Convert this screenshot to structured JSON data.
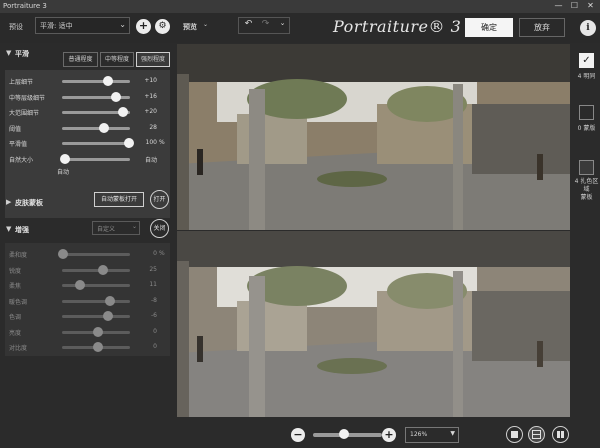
{
  "window": {
    "title": "Portraiture 3",
    "minimize": "—",
    "maximize": "☐",
    "close": "✕"
  },
  "header": {
    "preset_label": "预设",
    "preset_value": "平滑: 适中",
    "add_icon": "+",
    "settings_icon": "⚙",
    "preview_label": "预览",
    "logo": "Portraiture® 3",
    "ok_label": "确定",
    "cancel_label": "放弃",
    "info_icon": "i"
  },
  "smoothing": {
    "title": "平滑",
    "modes": [
      "普通程度",
      "中等程度",
      "强烈程度"
    ],
    "active_mode": "强烈程度",
    "sliders": [
      {
        "label": "上层细节",
        "value": "+10",
        "fraction": 0.68
      },
      {
        "label": "中等层级细节",
        "value": "+16",
        "fraction": 0.8
      },
      {
        "label": "大范围细节",
        "value": "+20",
        "fraction": 0.9
      },
      {
        "label": "阈值",
        "value": "28",
        "fraction": 0.62
      },
      {
        "label": "平滑值",
        "value": "100",
        "unit": "%",
        "fraction": 0.98
      },
      {
        "label": "自然大小",
        "value": "自动",
        "fraction": 0.05
      }
    ],
    "auto_text": "自动"
  },
  "skin_mask": {
    "title": "皮肤蒙板",
    "auto_mask_button": "自动蒙板打开",
    "toggle_button": "打开"
  },
  "enhance": {
    "title": "增强",
    "dropdown_value": "自定义",
    "toggle_button": "关闭",
    "sliders": [
      {
        "label": "柔和度",
        "value": "0",
        "unit": "%",
        "fraction": 0.02
      },
      {
        "label": "锐度",
        "value": "25",
        "fraction": 0.6
      },
      {
        "label": "柔焦",
        "value": "11",
        "fraction": 0.27
      },
      {
        "label": "暖色调",
        "value": "-8",
        "fraction": 0.7
      },
      {
        "label": "色调",
        "value": "-6",
        "fraction": 0.68
      },
      {
        "label": "亮度",
        "value": "0",
        "fraction": 0.53
      },
      {
        "label": "对比度",
        "value": "0",
        "fraction": 0.53
      }
    ]
  },
  "rail": {
    "check_icon": "✓",
    "label_1": "4 明同",
    "label_2": "0 蒙版",
    "label_3": "4 扎色区域\n蒙板"
  },
  "bottom": {
    "zoom_out_icon": "−",
    "zoom_in_icon": "+",
    "zoom_value": "126%",
    "zoom_fraction": 0.45
  },
  "colors": {
    "background": "#2b2b2b",
    "panel": "#3b3b3b",
    "accent": "#f2f2f2"
  }
}
